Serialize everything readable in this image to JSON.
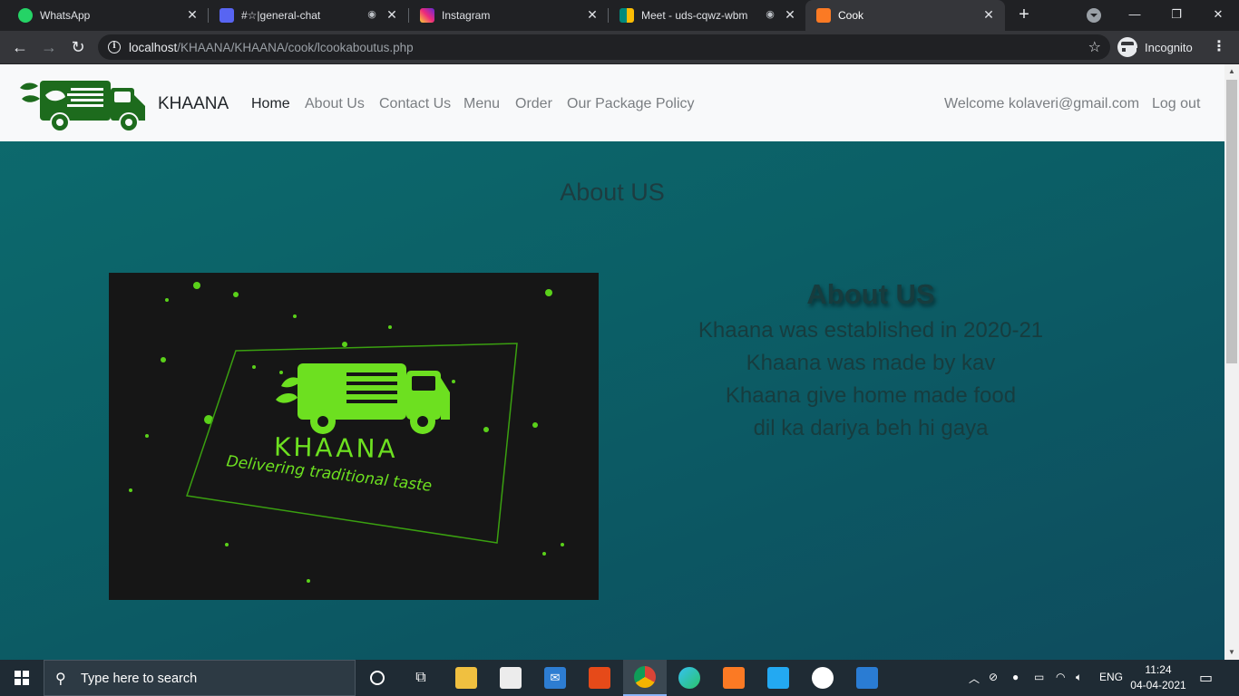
{
  "browser": {
    "tabs": [
      {
        "label": "WhatsApp",
        "icon": "whatsapp-icon",
        "color": "#25d366",
        "audio": false,
        "active": false
      },
      {
        "label": "#☆|general-chat",
        "icon": "discord-icon",
        "color": "#5865f2",
        "audio": true,
        "active": false
      },
      {
        "label": "Instagram",
        "icon": "instagram-icon",
        "color": "#e1306c",
        "audio": false,
        "active": false
      },
      {
        "label": "Meet - uds-cqwz-wbm",
        "icon": "google-meet-icon",
        "color": "#00897b",
        "audio": true,
        "active": false
      },
      {
        "label": "Cook",
        "icon": "xampp-icon",
        "color": "#fb7a24",
        "audio": false,
        "active": true
      }
    ],
    "url_host": "localhost",
    "url_path": "/KHAANA/KHAANA/cook/lcookaboutus.php",
    "profile_label": "Incognito"
  },
  "site": {
    "brand": "KHAANA",
    "nav": [
      {
        "label": "Home",
        "active": true
      },
      {
        "label": "About Us",
        "active": false
      },
      {
        "label": "Contact Us",
        "active": false
      },
      {
        "label": "Menu",
        "active": false
      },
      {
        "label": "Order",
        "active": false
      },
      {
        "label": "Our Package Policy",
        "active": false
      }
    ],
    "welcome": "Welcome kolaveri@gmail.com",
    "logout": "Log out",
    "page_heading": "About US",
    "about": {
      "heading": "About US",
      "lines": [
        "Khaana was established in 2020-21",
        "Khaana was made by kav",
        "Khaana give home made food",
        "dil ka dariya beh hi gaya"
      ]
    },
    "image": {
      "brand_text": "KHAANA",
      "tagline": "Delivering traditional taste"
    }
  },
  "taskbar": {
    "search_placeholder": "Type here to search",
    "language": "ENG",
    "time": "11:24",
    "date": "04-04-2021"
  }
}
